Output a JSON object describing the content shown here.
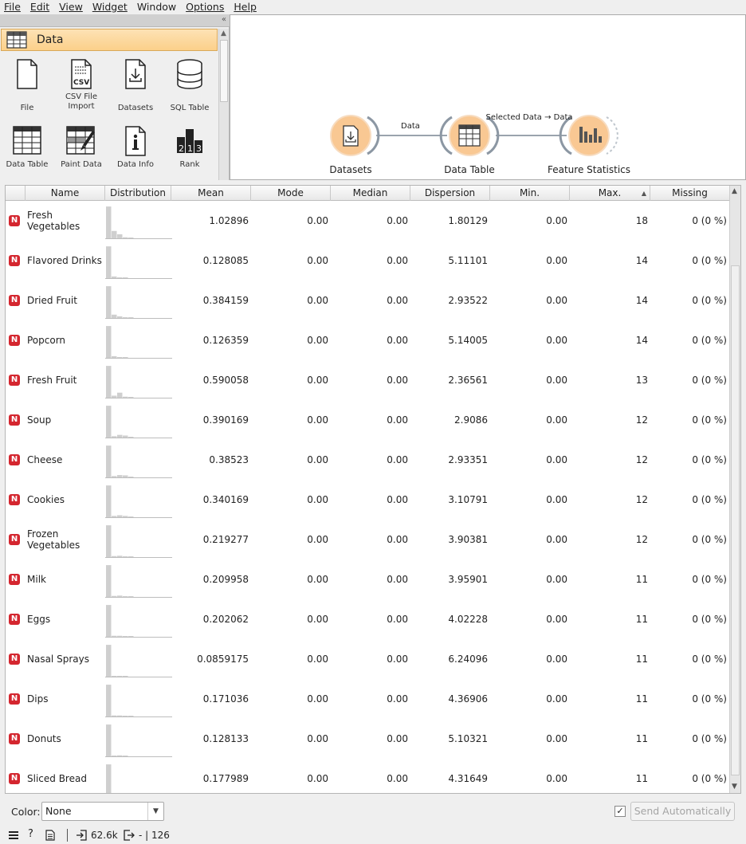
{
  "menu": [
    "File",
    "Edit",
    "View",
    "Widget",
    "Window",
    "Options",
    "Help"
  ],
  "toolbox": {
    "category": "Data",
    "tools": [
      "File",
      "CSV File Import",
      "Datasets",
      "SQL Table",
      "Data Table",
      "Paint Data",
      "Data Info",
      "Rank"
    ]
  },
  "canvas": {
    "nodes": [
      "Datasets",
      "Data Table",
      "Feature Statistics"
    ],
    "links": [
      "Data",
      "Selected Data → Data"
    ]
  },
  "table": {
    "columns": [
      "Name",
      "Distribution",
      "Mean",
      "Mode",
      "Median",
      "Dispersion",
      "Min.",
      "Max.",
      "Missing"
    ],
    "sorted_column": "Max.",
    "var_badge": "N",
    "rows": [
      {
        "name": "Fresh Vegetables",
        "mean": "1.02896",
        "mode": "0.00",
        "median": "0.00",
        "dispersion": "1.80129",
        "min": "0.00",
        "max": "18",
        "missing": "0 (0 %)",
        "dist": [
          0.95,
          0.22,
          0.12,
          0.03,
          0.01
        ]
      },
      {
        "name": "Flavored Drinks",
        "mean": "0.128085",
        "mode": "0.00",
        "median": "0.00",
        "dispersion": "5.11101",
        "min": "0.00",
        "max": "14",
        "missing": "0 (0 %)",
        "dist": [
          0.95,
          0.05,
          0.02,
          0.01,
          0.0
        ]
      },
      {
        "name": "Dried Fruit",
        "mean": "0.384159",
        "mode": "0.00",
        "median": "0.00",
        "dispersion": "2.93522",
        "min": "0.00",
        "max": "14",
        "missing": "0 (0 %)",
        "dist": [
          0.95,
          0.1,
          0.05,
          0.02,
          0.01
        ]
      },
      {
        "name": "Popcorn",
        "mean": "0.126359",
        "mode": "0.00",
        "median": "0.00",
        "dispersion": "5.14005",
        "min": "0.00",
        "max": "14",
        "missing": "0 (0 %)",
        "dist": [
          0.95,
          0.05,
          0.02,
          0.01,
          0.0
        ]
      },
      {
        "name": "Fresh Fruit",
        "mean": "0.590058",
        "mode": "0.00",
        "median": "0.00",
        "dispersion": "2.36561",
        "min": "0.00",
        "max": "13",
        "missing": "0 (0 %)",
        "dist": [
          0.95,
          0.06,
          0.15,
          0.03,
          0.01
        ]
      },
      {
        "name": "Soup",
        "mean": "0.390169",
        "mode": "0.00",
        "median": "0.00",
        "dispersion": "2.9086",
        "min": "0.00",
        "max": "12",
        "missing": "0 (0 %)",
        "dist": [
          0.95,
          0.04,
          0.08,
          0.06,
          0.01
        ]
      },
      {
        "name": "Cheese",
        "mean": "0.38523",
        "mode": "0.00",
        "median": "0.00",
        "dispersion": "2.93351",
        "min": "0.00",
        "max": "12",
        "missing": "0 (0 %)",
        "dist": [
          0.95,
          0.04,
          0.07,
          0.06,
          0.01
        ]
      },
      {
        "name": "Cookies",
        "mean": "0.340169",
        "mode": "0.00",
        "median": "0.00",
        "dispersion": "3.10791",
        "min": "0.00",
        "max": "12",
        "missing": "0 (0 %)",
        "dist": [
          0.95,
          0.04,
          0.06,
          0.04,
          0.01
        ]
      },
      {
        "name": "Frozen Vegetables",
        "mean": "0.219277",
        "mode": "0.00",
        "median": "0.00",
        "dispersion": "3.90381",
        "min": "0.00",
        "max": "12",
        "missing": "0 (0 %)",
        "dist": [
          0.95,
          0.03,
          0.04,
          0.02,
          0.01
        ]
      },
      {
        "name": "Milk",
        "mean": "0.209958",
        "mode": "0.00",
        "median": "0.00",
        "dispersion": "3.95901",
        "min": "0.00",
        "max": "11",
        "missing": "0 (0 %)",
        "dist": [
          0.95,
          0.03,
          0.04,
          0.02,
          0.01
        ]
      },
      {
        "name": "Eggs",
        "mean": "0.202062",
        "mode": "0.00",
        "median": "0.00",
        "dispersion": "4.02228",
        "min": "0.00",
        "max": "11",
        "missing": "0 (0 %)",
        "dist": [
          0.95,
          0.03,
          0.03,
          0.02,
          0.01
        ]
      },
      {
        "name": "Nasal Sprays",
        "mean": "0.0859175",
        "mode": "0.00",
        "median": "0.00",
        "dispersion": "6.24096",
        "min": "0.00",
        "max": "11",
        "missing": "0 (0 %)",
        "dist": [
          0.95,
          0.01,
          0.02,
          0.01,
          0.0
        ]
      },
      {
        "name": "Dips",
        "mean": "0.171036",
        "mode": "0.00",
        "median": "0.00",
        "dispersion": "4.36906",
        "min": "0.00",
        "max": "11",
        "missing": "0 (0 %)",
        "dist": [
          0.95,
          0.03,
          0.03,
          0.02,
          0.01
        ]
      },
      {
        "name": "Donuts",
        "mean": "0.128133",
        "mode": "0.00",
        "median": "0.00",
        "dispersion": "5.10321",
        "min": "0.00",
        "max": "11",
        "missing": "0 (0 %)",
        "dist": [
          0.95,
          0.02,
          0.03,
          0.01,
          0.0
        ]
      },
      {
        "name": "Sliced Bread",
        "mean": "0.177989",
        "mode": "0.00",
        "median": "0.00",
        "dispersion": "4.31649",
        "min": "0.00",
        "max": "11",
        "missing": "0 (0 %)",
        "dist": [
          0.95,
          0.03,
          0.03,
          0.02,
          0.01
        ]
      }
    ]
  },
  "controls": {
    "color_label": "Color:",
    "color_value": "None",
    "auto_checked": "✓",
    "send_label": "Send Automatically"
  },
  "status": {
    "input_size": "62.6k",
    "output_size": "- | 126"
  },
  "colors": {
    "accent": "#fcd08a",
    "badge": "#d4262f",
    "node_fill": "#f9c893"
  }
}
